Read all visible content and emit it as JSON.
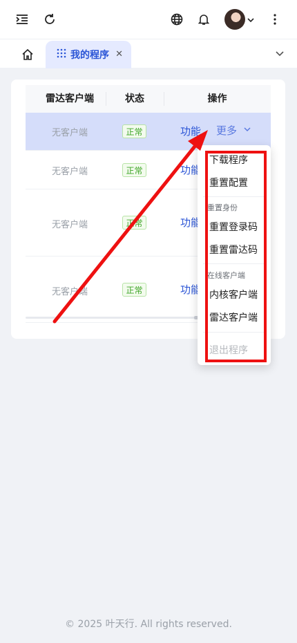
{
  "topbar": {
    "icons": [
      "menu-indent-icon",
      "refresh-icon",
      "globe-icon",
      "bell-icon",
      "avatar",
      "chevron-down-icon",
      "more-vertical-icon"
    ]
  },
  "tabs": {
    "home_icon": "home-icon",
    "active_label": "我的程序",
    "active_icon": "grid-dots-icon",
    "close_glyph": "✕"
  },
  "table": {
    "headers": [
      "雷达客户端",
      "状态",
      "操作"
    ],
    "rows": [
      {
        "client": "无客户端",
        "status": "正常",
        "func": "功能",
        "more": "更多"
      },
      {
        "client": "无客户端",
        "status": "正常",
        "func": "功能"
      },
      {
        "client": "无客户端",
        "status": "正常",
        "func": "功能"
      },
      {
        "client": "无客户端",
        "status": "正常",
        "func": "功能"
      }
    ]
  },
  "dropdown": {
    "item1": "下载程序",
    "item2": "重置配置",
    "group1": "重置身份",
    "item3": "重置登录码",
    "item4": "重置雷达码",
    "group2": "在线客户端",
    "item5": "内核客户端",
    "item6": "雷达客户端",
    "item7": "退出程序"
  },
  "colors": {
    "accent": "#2b55d6",
    "highlight_row": "#d5ddfa",
    "annotation_red": "#ee1111",
    "status_green": "#3ea527"
  },
  "footer": {
    "copyright": "© 2025 叶天行. All rights reserved."
  }
}
